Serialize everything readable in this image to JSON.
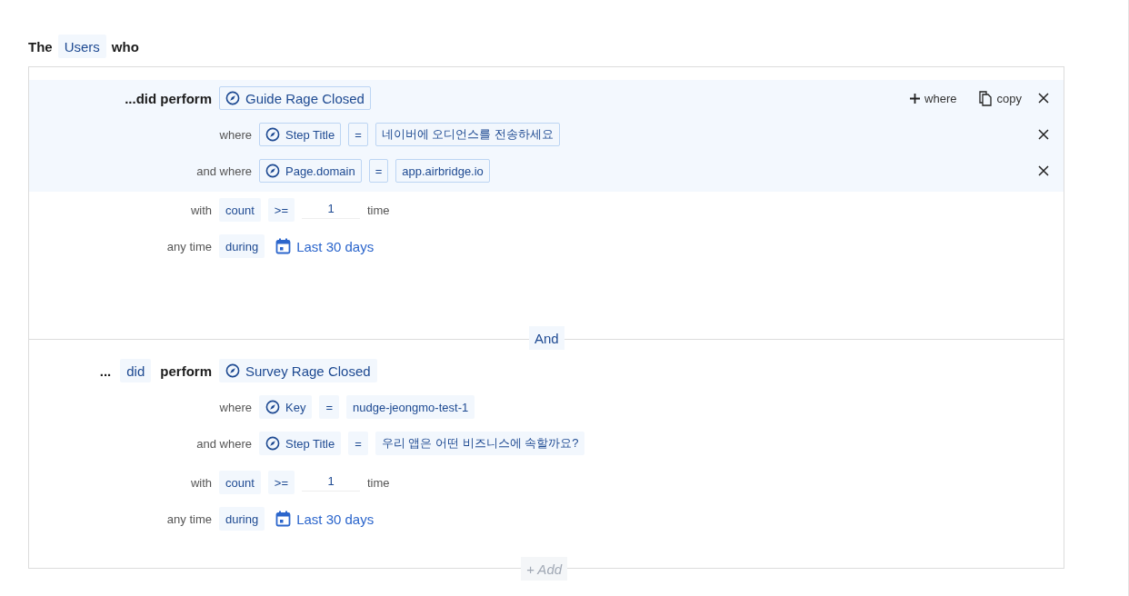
{
  "header": {
    "lead": "The",
    "subject": "Users",
    "tail": "who"
  },
  "blocks": [
    {
      "highlighted": true,
      "prefix": [
        {
          "text": "...did perform",
          "kind": "bold"
        }
      ],
      "event": "Guide Rage Closed",
      "actions": [
        {
          "label": "where",
          "kind": "add"
        },
        {
          "label": "copy",
          "kind": "copy"
        }
      ],
      "filters": [
        {
          "label": "where",
          "property": "Step Title",
          "operator": "=",
          "value": "네이버에 오디언스를 전송하세요"
        },
        {
          "label": "and where",
          "property": "Page.domain",
          "operator": "=",
          "value": "app.airbridge.io"
        }
      ],
      "frequency": {
        "label": "with",
        "metric": "count",
        "operator": ">=",
        "value": "1",
        "unit": "time"
      },
      "timeframe": {
        "label": "any time",
        "operator": "during",
        "range": "Last 30 days"
      }
    },
    {
      "highlighted": false,
      "prefix": [
        {
          "text": "...",
          "kind": "bold"
        },
        {
          "text": "did",
          "kind": "chip"
        },
        {
          "text": "perform",
          "kind": "bold"
        }
      ],
      "event": "Survey Rage Closed",
      "filters": [
        {
          "label": "where",
          "property": "Key",
          "operator": "=",
          "value": "nudge-jeongmo-test-1"
        },
        {
          "label": "and where",
          "property": "Step Title",
          "operator": "=",
          "value": "우리 앱은 어떤 비즈니스에 속할까요?"
        }
      ],
      "frequency": {
        "label": "with",
        "metric": "count",
        "operator": ">=",
        "value": "1",
        "unit": "time"
      },
      "timeframe": {
        "label": "any time",
        "operator": "during",
        "range": "Last 30 days"
      }
    }
  ],
  "connector": "And",
  "add_button": "+ Add"
}
